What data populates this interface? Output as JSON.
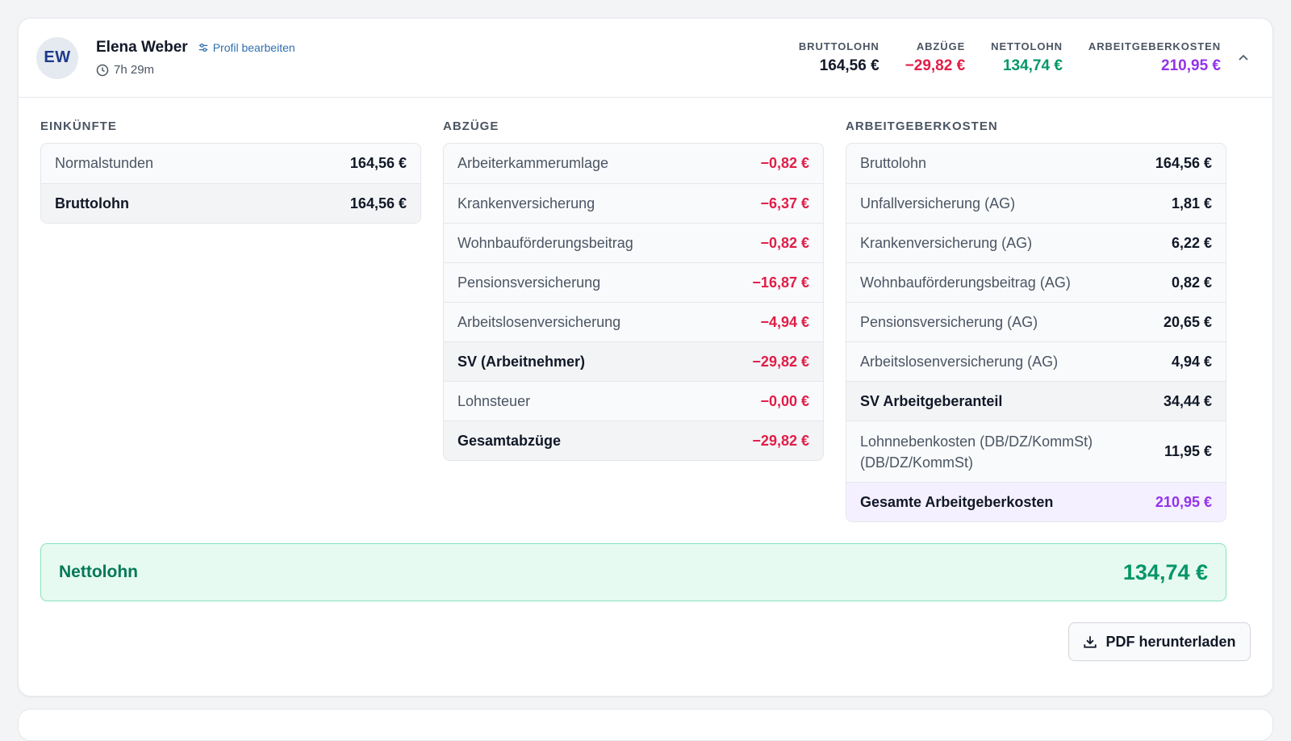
{
  "employee": {
    "initials": "EW",
    "name": "Elena Weber",
    "edit_label": "Profil bearbeiten",
    "hours": "7h 29m"
  },
  "summary": [
    {
      "label": "BRUTTOLOHN",
      "value": "164,56 €"
    },
    {
      "label": "ABZÜGE",
      "value": "−29,82 €"
    },
    {
      "label": "NETTOLOHN",
      "value": "134,74 €"
    },
    {
      "label": "ARBEITGEBERKOSTEN",
      "value": "210,95 €"
    }
  ],
  "income": {
    "title": "EINKÜNFTE",
    "rows": [
      {
        "label": "Normalstunden",
        "value": "164,56 €"
      },
      {
        "label": "Bruttolohn",
        "value": "164,56 €"
      }
    ]
  },
  "deductions": {
    "title": "ABZÜGE",
    "rows": [
      {
        "label": "Arbeiterkammerumlage",
        "value": "−0,82 €"
      },
      {
        "label": "Krankenversicherung",
        "value": "−6,37 €"
      },
      {
        "label": "Wohnbauförderungsbeitrag",
        "value": "−0,82 €"
      },
      {
        "label": "Pensionsversicherung",
        "value": "−16,87 €"
      },
      {
        "label": "Arbeitslosenversicherung",
        "value": "−4,94 €"
      },
      {
        "label": "SV (Arbeitnehmer)",
        "value": "−29,82 €"
      },
      {
        "label": "Lohnsteuer",
        "value": "−0,00 €"
      },
      {
        "label": "Gesamtabzüge",
        "value": "−29,82 €"
      }
    ]
  },
  "employer": {
    "title": "ARBEITGEBERKOSTEN",
    "rows": [
      {
        "label": "Bruttolohn",
        "value": "164,56 €"
      },
      {
        "label": "Unfallversicherung (AG)",
        "value": "1,81 €"
      },
      {
        "label": "Krankenversicherung (AG)",
        "value": "6,22 €"
      },
      {
        "label": "Wohnbauförderungsbeitrag (AG)",
        "value": "0,82 €"
      },
      {
        "label": "Pensionsversicherung (AG)",
        "value": "20,65 €"
      },
      {
        "label": "Arbeitslosenversicherung (AG)",
        "value": "4,94 €"
      },
      {
        "label": "SV Arbeitgeberanteil",
        "value": "34,44 €"
      },
      {
        "label": "Lohnnebenkosten (DB/DZ/KommSt) (DB/DZ/KommSt)",
        "value": "11,95 €"
      },
      {
        "label": "Gesamte Arbeitgeberkosten",
        "value": "210,95 €"
      }
    ]
  },
  "net": {
    "label": "Nettolohn",
    "value": "134,74 €"
  },
  "pdf_button": {
    "label": "PDF herunterladen"
  },
  "colors": {
    "red": "#e11d48",
    "green": "#059669",
    "purple": "#9333ea"
  }
}
